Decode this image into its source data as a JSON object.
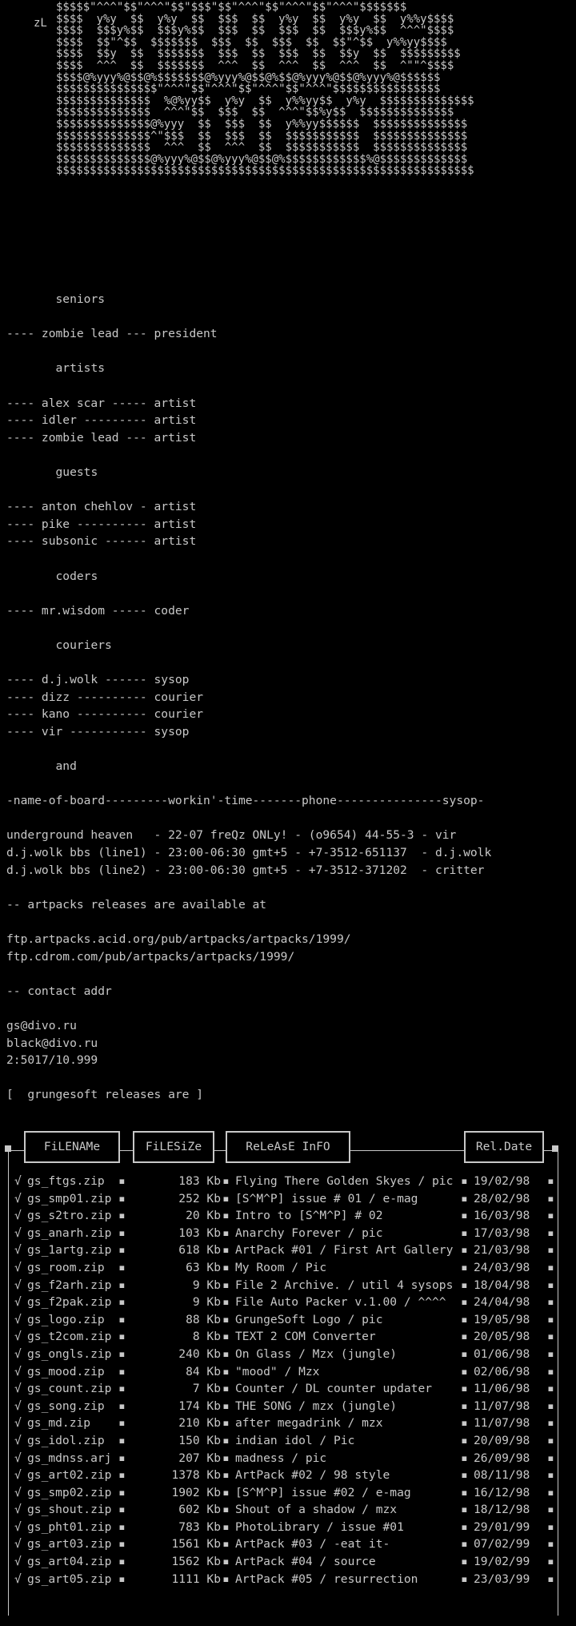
{
  "logo": {
    "signature": "zL",
    "art_lines": [
      "$$$$$\"^^^\"$$\"^^^\"$$\"$$$\"$$\"^^^\"$$\"^^^\"$$\"^^^\"$$$$$$$",
      "$$$$  y%y  $$  y%y  $$  $$$  $$  y%y  $$  y%y  $$  y%%y$$$$",
      "$$$$  $$$y%$$  $$$y%$$  $$$  $$  $$$  $$  $$$y%$$  ^^^\"$$$$",
      "$$$$  $$\"^$$  $$$$$$$  $$$  $$  $$$  $$  $$\"^$$  y%%yy$$$$",
      "$$$$  $$y  $$  $$$$$$$  $$$  $$  $$$  $$  $$y  $$  $$$$$$$$$",
      "$$$$  ^^^  $$  $$$$$$$  ^^^  $$  ^^^  $$  ^^^  $$  ^\"\"^$$$$",
      "$$$$@%yyy%@$$@%$$$$$$$@%yyy%@$$@%$$@%yyy%@$$@%yyy%@$$$$$$",
      "$$$$$$$$$$$$$$$\"^^^\"$$\"^^^\"$$\"^^^\"$$\"^^^\"$$$$$$$$$$$$$$$$",
      "$$$$$$$$$$$$$$  %@%yy$$  y%y  $$  y%%yy$$  y%y  $$$$$$$$$$$$$$",
      "$$$$$$$$$$$$$$  ^^^\"$$  $$$  $$  ^^^\"$$%y$$  $$$$$$$$$$$$$$",
      "$$$$$$$$$$$$$$@%yyy  $$  $$$  $$  y%%yy$$$$$$  $$$$$$$$$$$$$$",
      "$$$$$$$$$$$$$$^\"$$$  $$  $$$  $$  $$$$$$$$$$$  $$$$$$$$$$$$$$",
      "$$$$$$$$$$$$$$  ^^^  $$  ^^^  $$  $$$$$$$$$$$  $$$$$$$$$$$$$$",
      "$$$$$$$$$$$$$$@%yyy%@$$@%yyy%@$$@%$$$$$$$$$$$$%@$$$$$$$$$$$$$",
      "$$$$$$$$$$$$$$$$$$$$$$$$$$$$$$$$$$$$$$$$$$$$$$$$$$$$$$$$$$$$$$"
    ]
  },
  "sections": {
    "seniors": {
      "title": "seniors",
      "members": [
        "---- zombie lead --- president"
      ]
    },
    "artists": {
      "title": "artists",
      "members": [
        "---- alex scar ----- artist",
        "---- idler --------- artist",
        "---- zombie lead --- artist"
      ]
    },
    "guests": {
      "title": "guests",
      "members": [
        "---- anton chehlov - artist",
        "---- pike ---------- artist",
        "---- subsonic ------ artist"
      ]
    },
    "coders": {
      "title": "coders",
      "members": [
        "---- mr.wisdom ----- coder"
      ]
    },
    "couriers": {
      "title": "couriers",
      "members": [
        "---- d.j.wolk ------ sysop",
        "---- dizz ---------- courier",
        "---- kano ---------- courier",
        "---- vir ----------- sysop"
      ]
    },
    "and": {
      "title": "and"
    }
  },
  "boards": {
    "header": "-name-of-board---------workin'-time-------phone---------------sysop-",
    "rows": [
      "underground heaven   - 22-07 freQz ONLy! - (o9654) 44-55-3 - vir",
      "d.j.wolk bbs (line1) - 23:00-06:30 gmt+5 - +7-3512-651137  - d.j.wolk",
      "d.j.wolk bbs (line2) - 23:00-06:30 gmt+5 - +7-3512-371202  - critter"
    ]
  },
  "artpacks": {
    "heading": "-- artpacks releases are available at",
    "urls": [
      "ftp.artpacks.acid.org/pub/artpacks/artpacks/1999/",
      "ftp.cdrom.com/pub/artpacks/artpacks/1999/"
    ]
  },
  "contact": {
    "heading": "-- contact addr",
    "lines": [
      "gs@divo.ru",
      "black@divo.ru",
      "2:5017/10.999"
    ]
  },
  "releases_intro": "[  grungesoft releases are ]",
  "table": {
    "headers": {
      "filename": "FiLENAMe",
      "filesize": "FiLESiZe",
      "info": "ReLeAsE InFO",
      "date": "Rel.Date"
    },
    "rows": [
      {
        "file": "gs_ftgs.zip",
        "size": "183 Kb",
        "info": "Flying There Golden Skyes / pic",
        "date": "19/02/98"
      },
      {
        "file": "gs_smp01.zip",
        "size": "252 Kb",
        "info": "[S^M^P] issue # 01 / e-mag",
        "date": "28/02/98"
      },
      {
        "file": "gs_s2tro.zip",
        "size": "20 Kb",
        "info": "Intro to [S^M^P] # 02",
        "date": "16/03/98"
      },
      {
        "file": "gs_anarh.zip",
        "size": "103 Kb",
        "info": "Anarchy Forever / pic",
        "date": "17/03/98"
      },
      {
        "file": "gs_1artg.zip",
        "size": "618 Kb",
        "info": "ArtPack #01 / First Art Gallery",
        "date": "21/03/98"
      },
      {
        "file": "gs_room.zip",
        "size": "63 Kb",
        "info": "My Room / Pic",
        "date": "24/03/98"
      },
      {
        "file": "gs_f2arh.zip",
        "size": "9 Kb",
        "info": "File 2 Archive. / util 4 sysops",
        "date": "18/04/98"
      },
      {
        "file": "gs_f2pak.zip",
        "size": "9 Kb",
        "info": "File Auto Packer v.1.00 / ^^^^",
        "date": "24/04/98"
      },
      {
        "file": "gs_logo.zip",
        "size": "88 Kb",
        "info": "GrungeSoft Logo / pic",
        "date": "19/05/98"
      },
      {
        "file": "gs_t2com.zip",
        "size": "8 Kb",
        "info": "TEXT 2 COM Converter",
        "date": "20/05/98"
      },
      {
        "file": "gs_ongls.zip",
        "size": "240 Kb",
        "info": "On Glass / Mzx (jungle)",
        "date": "01/06/98"
      },
      {
        "file": "gs_mood.zip",
        "size": "84 Kb",
        "info": "\"mood\" / Mzx",
        "date": "02/06/98"
      },
      {
        "file": "gs_count.zip",
        "size": "7 Kb",
        "info": "Counter / DL counter updater",
        "date": "11/06/98"
      },
      {
        "file": "gs_song.zip",
        "size": "174 Kb",
        "info": "THE SONG / mzx (jungle)",
        "date": "11/07/98"
      },
      {
        "file": "gs_md.zip",
        "size": "210 Kb",
        "info": "after megadrink / mzx",
        "date": "11/07/98"
      },
      {
        "file": "gs_idol.zip",
        "size": "150 Kb",
        "info": "indian idol / Pic",
        "date": "20/09/98"
      },
      {
        "file": "gs_mdnss.arj",
        "size": "207 Kb",
        "info": "madness / pic",
        "date": "26/09/98"
      },
      {
        "file": "gs_art02.zip",
        "size": "1378 Kb",
        "info": "ArtPack #02 / 98 style",
        "date": "08/11/98"
      },
      {
        "file": "gs_smp02.zip",
        "size": "1902 Kb",
        "info": "[S^M^P] issue #02 / e-mag",
        "date": "16/12/98"
      },
      {
        "file": "gs_shout.zip",
        "size": "602 Kb",
        "info": "Shout of a shadow / mzx",
        "date": "18/12/98"
      },
      {
        "file": "gs_pht01.zip",
        "size": "783 Kb",
        "info": "PhotoLibrary / issue #01",
        "date": "29/01/99"
      },
      {
        "file": "gs_art03.zip",
        "size": "1561 Kb",
        "info": "ArtPack #03 / -eat it-",
        "date": "07/02/99"
      },
      {
        "file": "gs_art04.zip",
        "size": "1562 Kb",
        "info": "ArtPack #04 / source",
        "date": "19/02/99"
      },
      {
        "file": "gs_art05.zip",
        "size": "1111 Kb",
        "info": "ArtPack #05 / resurrection",
        "date": "23/03/99"
      }
    ]
  }
}
